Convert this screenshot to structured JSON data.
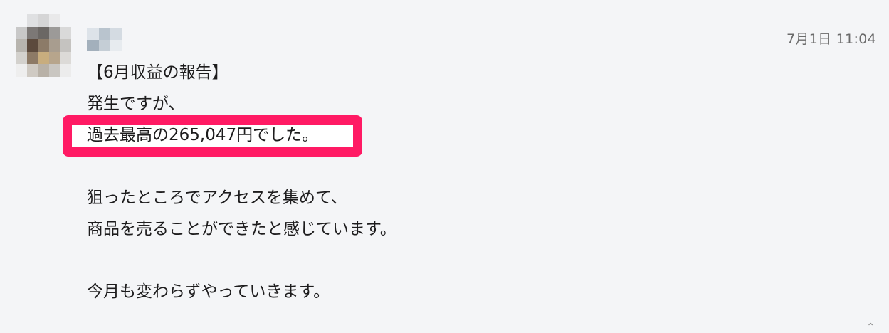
{
  "message": {
    "timestamp": "7月1日 11:04",
    "lines": [
      "【6月収益の報告】",
      "発生ですが、",
      "過去最高の265,047円でした。",
      "",
      "狙ったところでアクセスを集めて、",
      "商品を売ることができたと感じています。",
      "",
      "今月も変わらずやっていきます。"
    ]
  },
  "colors": {
    "highlight_border": "#ff1a64",
    "background": "#f4f5f7",
    "text": "#1d1c1d",
    "timestamp": "#6b6b6b"
  },
  "icons": {
    "avatar": "avatar-icon",
    "corner": "caret-up-icon"
  }
}
